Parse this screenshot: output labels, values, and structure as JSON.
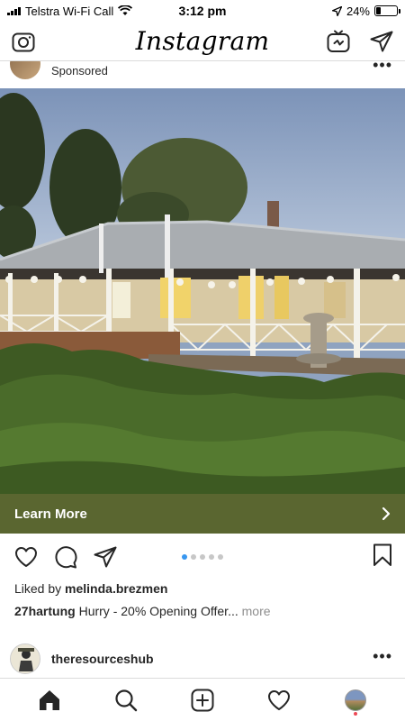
{
  "status_bar": {
    "carrier": "Telstra Wi-Fi Call",
    "time": "3:12 pm",
    "battery": "24%",
    "battery_level": 0.24
  },
  "header": {
    "title": "Instagram",
    "icons": [
      "camera-icon",
      "igtv-icon",
      "direct-message-icon"
    ]
  },
  "post": {
    "label": "Sponsored",
    "cta_label": "Learn More",
    "carousel_count": 5,
    "carousel_active": 1,
    "likes_prefix": "Liked by",
    "liked_by": "melinda.brezmen",
    "caption_user": "27hartung",
    "caption_text": "Hurry - 20% Opening Offer...",
    "caption_more": "more"
  },
  "next_post": {
    "username": "theresourceshub"
  },
  "bottom_nav": {
    "items": [
      "home-icon",
      "search-icon",
      "new-post-icon",
      "activity-icon",
      "profile-avatar"
    ]
  },
  "colors": {
    "cta_bg": "#5a6630",
    "carousel_active": "#3897f0",
    "notification": "#ed4956"
  }
}
